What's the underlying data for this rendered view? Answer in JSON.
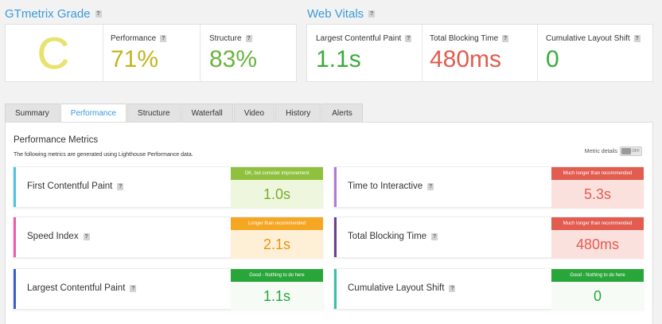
{
  "grade": {
    "title": "GTmetrix Grade",
    "letter": "C",
    "performance_label": "Performance",
    "performance_value": "71%",
    "structure_label": "Structure",
    "structure_value": "83%"
  },
  "vitals": {
    "title": "Web Vitals",
    "lcp_label": "Largest Contentful Paint",
    "lcp_value": "1.1s",
    "tbt_label": "Total Blocking Time",
    "tbt_value": "480ms",
    "cls_label": "Cumulative Layout Shift",
    "cls_value": "0"
  },
  "tabs": [
    "Summary",
    "Performance",
    "Structure",
    "Waterfall",
    "Video",
    "History",
    "Alerts"
  ],
  "active_tab": "Performance",
  "panel": {
    "title": "Performance Metrics",
    "description": "The following metrics are generated using Lighthouse Performance data.",
    "toggle_label": "Metric details",
    "toggle_state": "OFF"
  },
  "metrics": [
    {
      "label": "First Contentful Paint",
      "status": "OK, but consider improvement",
      "value": "1.0s",
      "accent": "#4cc5e0",
      "status_color": "#8fc13e",
      "value_bg": "#eef6dd",
      "value_color": "#7aab2c"
    },
    {
      "label": "Time to Interactive",
      "status": "Much longer than recommended",
      "value": "5.3s",
      "accent": "#b27ad6",
      "status_color": "#e25c50",
      "value_bg": "#fbe1de",
      "value_color": "#e25c50"
    },
    {
      "label": "Speed Index",
      "status": "Longer than recommended",
      "value": "2.1s",
      "accent": "#f05aa8",
      "status_color": "#f5a623",
      "value_bg": "#fdf0d7",
      "value_color": "#e69410"
    },
    {
      "label": "Total Blocking Time",
      "status": "Much longer than recommended",
      "value": "480ms",
      "accent": "#6c3f8e",
      "status_color": "#e25c50",
      "value_bg": "#fbe1de",
      "value_color": "#e25c50"
    },
    {
      "label": "Largest Contentful Paint",
      "status": "Good - Nothing to do here",
      "value": "1.1s",
      "accent": "#3a5fcd",
      "status_color": "#29a63a",
      "value_bg": "#f6fbf6",
      "value_color": "#29a63a"
    },
    {
      "label": "Cumulative Layout Shift",
      "status": "Good - Nothing to do here",
      "value": "0",
      "accent": "#37c3a2",
      "status_color": "#29a63a",
      "value_bg": "#f6fbf6",
      "value_color": "#29a63a"
    }
  ],
  "colors": {
    "grade_letter": "#e8e36c",
    "performance": "#c4b41f",
    "structure": "#6cb33e",
    "lcp": "#3bab3b",
    "tbt": "#e25c50",
    "cls": "#3bab3b",
    "link": "#3a9ad9"
  },
  "help_icon": "?"
}
